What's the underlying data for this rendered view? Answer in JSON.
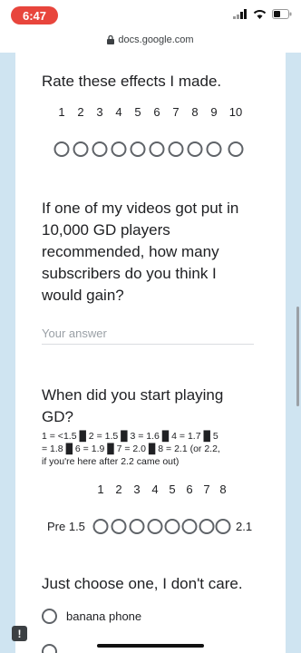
{
  "status_bar": {
    "time": "6:47"
  },
  "browser": {
    "url": "docs.google.com"
  },
  "question1": {
    "title": "Rate these effects I made.",
    "scale_labels": [
      "1",
      "2",
      "3",
      "4",
      "5",
      "6",
      "7",
      "8",
      "9",
      "10"
    ]
  },
  "question2": {
    "title_lines": [
      "If one of my videos got put in",
      "10,000 GD players",
      "recommended, how many",
      "subscribers do you think I",
      "would gain?"
    ],
    "placeholder": "Your answer"
  },
  "question3": {
    "title_lines": [
      "When did you start playing",
      "GD?"
    ],
    "description_lines": [
      "1 = <1.5 █ 2 = 1.5 █ 3 = 1.6 █ 4 = 1.7 █ 5",
      "= 1.8 █ 6 = 1.9 █ 7 = 2.0 █ 8 = 2.1 (or 2.2,",
      "if you're here after 2.2 came out)"
    ],
    "scale_labels": [
      "1",
      "2",
      "3",
      "4",
      "5",
      "6",
      "7",
      "8"
    ],
    "low_label": "Pre 1.5",
    "high_label": "2.1"
  },
  "question4": {
    "title": "Just choose one, I don't care.",
    "options": [
      "banana phone"
    ]
  },
  "colors": {
    "page_background": "#cfe4f1",
    "time_pill": "#e8453c",
    "radio_border": "#5f6368"
  }
}
